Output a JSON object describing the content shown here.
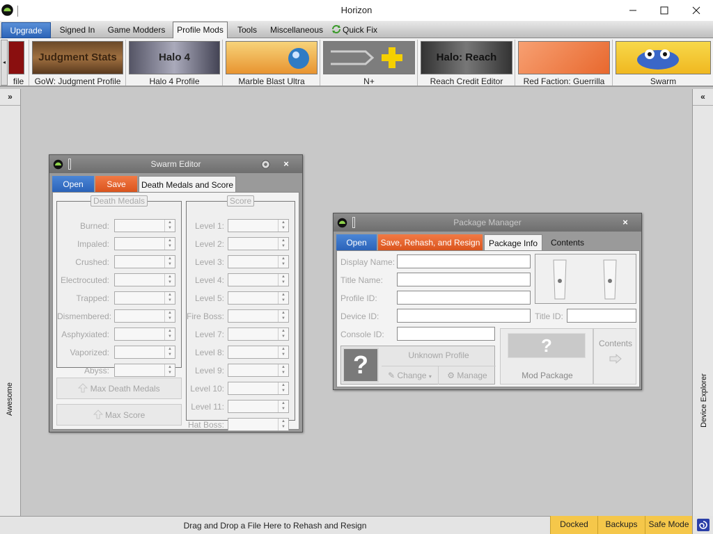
{
  "window": {
    "title": "Horizon"
  },
  "menu_tabs": [
    {
      "label": "Upgrade"
    },
    {
      "label": "Signed In"
    },
    {
      "label": "Game Modders"
    },
    {
      "label": "Profile Mods"
    },
    {
      "label": "Tools"
    },
    {
      "label": "Miscellaneous"
    },
    {
      "label": "Quick Fix"
    }
  ],
  "ribbon": {
    "items": [
      {
        "caption": "file",
        "image_text": ""
      },
      {
        "caption": "GoW: Judgment Profile",
        "image_text": "Judgment Stats"
      },
      {
        "caption": "Halo 4 Profile",
        "image_text": "Halo 4"
      },
      {
        "caption": "Marble Blast Ultra",
        "image_text": ""
      },
      {
        "caption": "N+",
        "image_text": ""
      },
      {
        "caption": "Reach Credit Editor",
        "image_text": "Halo: Reach"
      },
      {
        "caption": "Red Faction: Guerrilla",
        "image_text": ""
      },
      {
        "caption": "Swarm",
        "image_text": ""
      }
    ]
  },
  "left_panel": {
    "label": "Awesome",
    "expand_glyph": "»"
  },
  "right_panel": {
    "label": "Device Explorer",
    "expand_glyph": "«"
  },
  "swarm_editor": {
    "title": "Swarm Editor",
    "tabs": [
      {
        "label": "Open"
      },
      {
        "label": "Save"
      },
      {
        "label": "Death Medals and Score"
      }
    ],
    "death_medals": {
      "legend": "Death Medals",
      "fields": [
        {
          "label": "Burned:",
          "value": ""
        },
        {
          "label": "Impaled:",
          "value": ""
        },
        {
          "label": "Crushed:",
          "value": ""
        },
        {
          "label": "Electrocuted:",
          "value": ""
        },
        {
          "label": "Trapped:",
          "value": ""
        },
        {
          "label": "Dismembered:",
          "value": ""
        },
        {
          "label": "Asphyxiated:",
          "value": ""
        },
        {
          "label": "Vaporized:",
          "value": ""
        },
        {
          "label": "Abyss:",
          "value": ""
        }
      ]
    },
    "score": {
      "legend": "Score",
      "fields": [
        {
          "label": "Level 1:",
          "value": ""
        },
        {
          "label": "Level 2:",
          "value": ""
        },
        {
          "label": "Level 3:",
          "value": ""
        },
        {
          "label": "Level 4:",
          "value": ""
        },
        {
          "label": "Level 5:",
          "value": ""
        },
        {
          "label": "Fire Boss:",
          "value": ""
        },
        {
          "label": "Level 7:",
          "value": ""
        },
        {
          "label": "Level 8:",
          "value": ""
        },
        {
          "label": "Level 9:",
          "value": ""
        },
        {
          "label": "Level 10:",
          "value": ""
        },
        {
          "label": "Level 11:",
          "value": ""
        },
        {
          "label": "Hat Boss:",
          "value": ""
        }
      ]
    },
    "max_death_medals_label": "Max Death Medals",
    "max_score_label": "Max Score"
  },
  "package_manager": {
    "title": "Package Manager",
    "tabs": [
      {
        "label": "Open"
      },
      {
        "label": "Save, Rehash, and Resign"
      },
      {
        "label": "Package Info"
      },
      {
        "label": "Contents"
      }
    ],
    "fields": {
      "display_name": {
        "label": "Display Name:",
        "value": ""
      },
      "title_name": {
        "label": "Title Name:",
        "value": ""
      },
      "profile_id": {
        "label": "Profile ID:",
        "value": ""
      },
      "device_id": {
        "label": "Device ID:",
        "value": ""
      },
      "title_id": {
        "label": "Title ID:",
        "value": ""
      },
      "console_id": {
        "label": "Console ID:",
        "value": ""
      }
    },
    "profile_name": "Unknown Profile",
    "change_label": "Change",
    "manage_label": "Manage",
    "mod_package_label": "Mod Package",
    "contents_label": "Contents",
    "unknown_glyph": "?"
  },
  "statusbar": {
    "message": "Drag and Drop a File Here to Rehash and Resign",
    "buttons": [
      {
        "label": "Docked"
      },
      {
        "label": "Backups"
      },
      {
        "label": "Safe Mode"
      }
    ]
  },
  "colors": {
    "accent_blue": "#2a62b8",
    "accent_orange": "#d9531c",
    "status_yellow": "#f5c74a",
    "workspace": "#c8c8c8"
  }
}
